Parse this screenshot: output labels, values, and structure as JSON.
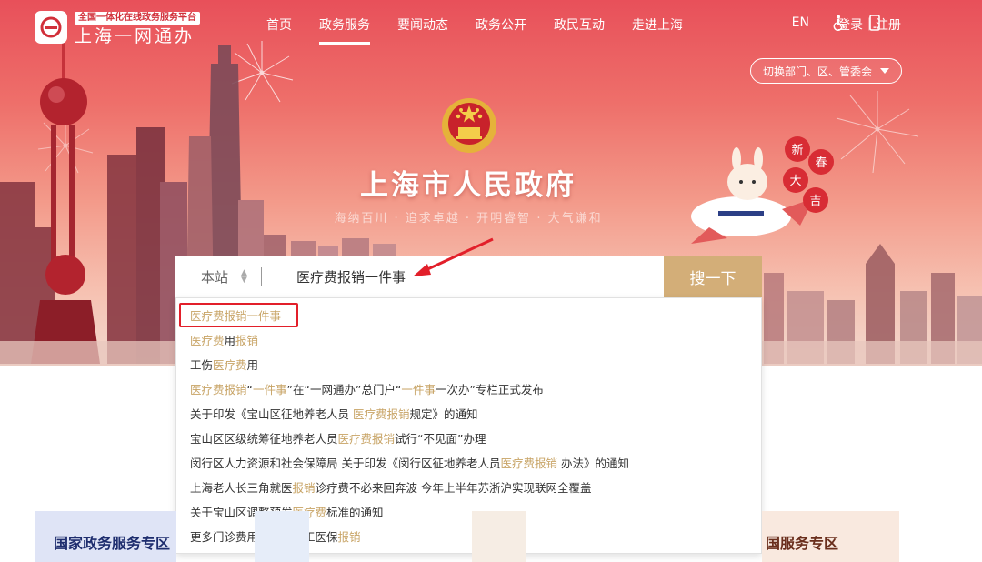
{
  "header": {
    "logo_tagline": "全国一体化在线政务服务平台",
    "logo_name": "上海一网通办",
    "nav": [
      "首页",
      "政务服务",
      "要闻动态",
      "政务公开",
      "政民互动",
      "走进上海"
    ],
    "active_nav": "政务服务",
    "lang": "EN",
    "login": "登录｜注册",
    "icons": [
      "accessibility-icon",
      "mobile-icon"
    ]
  },
  "switch_dept": "切换部门、区、管委会",
  "gov_title": "上海市人民政府",
  "motto": "海纳百川 · 追求卓越 · 开明睿智 · 大气谦和",
  "festive": [
    "新",
    "春",
    "大",
    "吉"
  ],
  "search": {
    "scope": "本站",
    "value": "医疗费报销一件事",
    "button": "搜一下"
  },
  "suggestions": [
    [
      {
        "t": "医疗费报销一件事",
        "h": true
      }
    ],
    [
      {
        "t": "医疗费",
        "h": true
      },
      {
        "t": "用",
        "h": false
      },
      {
        "t": "报销",
        "h": true
      }
    ],
    [
      {
        "t": "工伤",
        "h": false
      },
      {
        "t": "医疗费",
        "h": true
      },
      {
        "t": "用",
        "h": false
      }
    ],
    [
      {
        "t": "医疗费报销",
        "h": true
      },
      {
        "t": "“",
        "h": false
      },
      {
        "t": "一件事",
        "h": true
      },
      {
        "t": "”在“一网通办”总门户“",
        "h": false
      },
      {
        "t": "一件事",
        "h": true
      },
      {
        "t": "一次办”专栏正式发布",
        "h": false
      }
    ],
    [
      {
        "t": "关于印发《宝山区征地养老人员 ",
        "h": false
      },
      {
        "t": "医疗费报销",
        "h": true
      },
      {
        "t": "规定》的通知",
        "h": false
      }
    ],
    [
      {
        "t": "宝山区区级统筹征地养老人员",
        "h": false
      },
      {
        "t": "医疗费报销",
        "h": true
      },
      {
        "t": "试行“不见面”办理",
        "h": false
      }
    ],
    [
      {
        "t": "闵行区人力资源和社会保障局 关于印发《闵行区征地养老人员",
        "h": false
      },
      {
        "t": "医疗费报销",
        "h": true
      },
      {
        "t": " 办法》的通知",
        "h": false
      }
    ],
    [
      {
        "t": "上海老人长三角就医",
        "h": false
      },
      {
        "t": "报销",
        "h": true
      },
      {
        "t": "诊疗费不必来回奔波 今年上半年苏浙沪实现联网全覆盖",
        "h": false
      }
    ],
    [
      {
        "t": "关于宝山区调整预发",
        "h": false
      },
      {
        "t": "医疗费",
        "h": true
      },
      {
        "t": "标准的通知",
        "h": false
      }
    ],
    [
      {
        "t": "更多门诊费用将纳入职工医保",
        "h": false
      },
      {
        "t": "报销",
        "h": true
      }
    ]
  ],
  "cards": {
    "left": "国家政务服务专区",
    "right": "国服务专区"
  },
  "colors": {
    "accent_gold": "#d3ae78",
    "highlight": "#c8a466",
    "hero_red": "#e8505a",
    "annotation_red": "#e21f2a"
  }
}
